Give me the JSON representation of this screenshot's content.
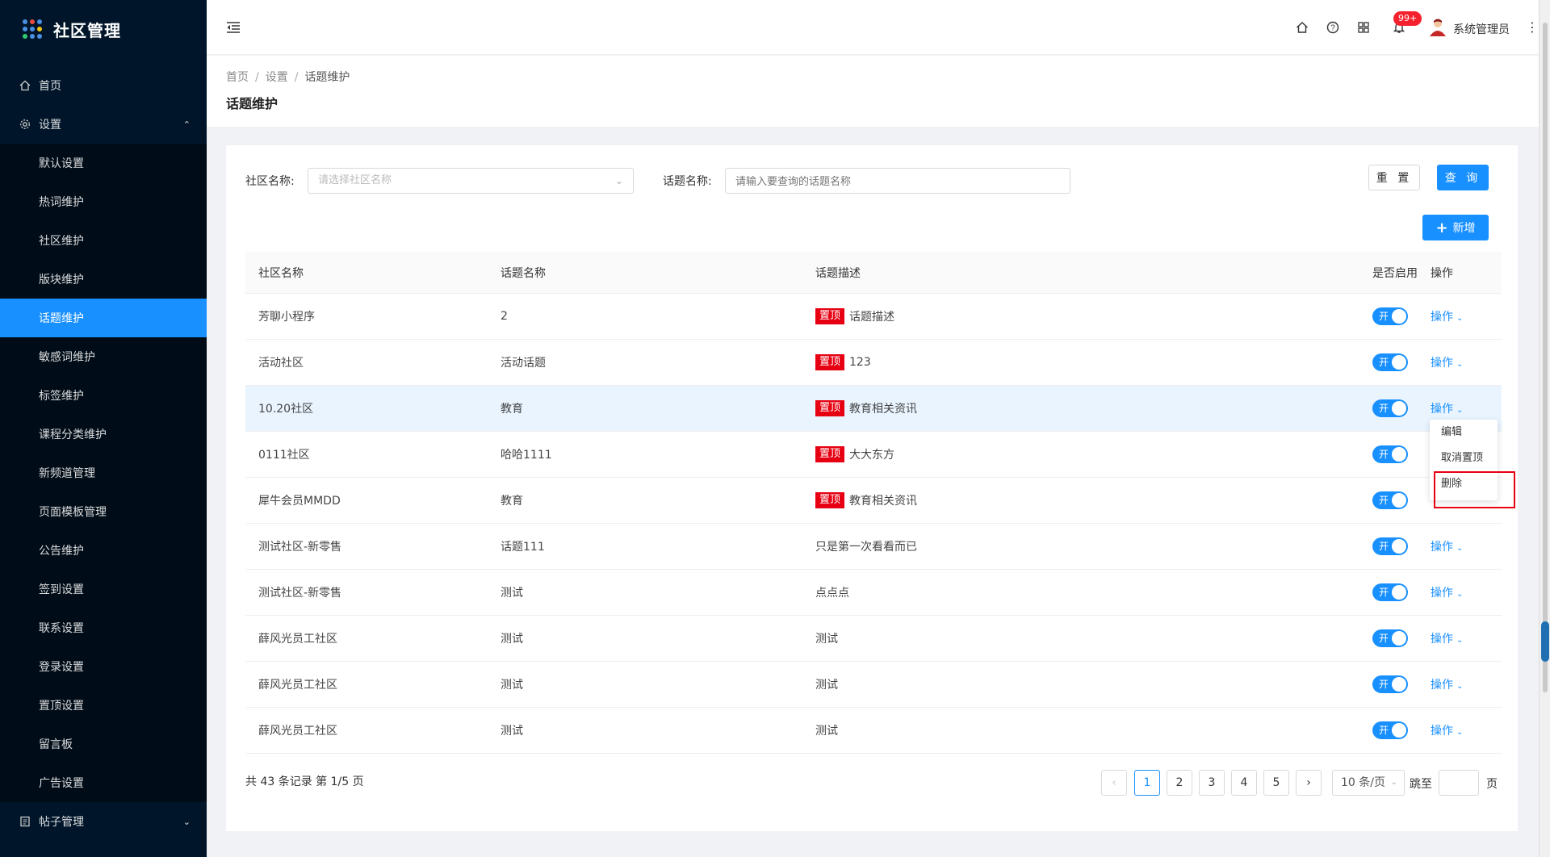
{
  "app": {
    "title": "社区管理"
  },
  "sidebar": {
    "home": "首页",
    "settings": "设置",
    "settings_items": [
      "默认设置",
      "热词维护",
      "社区维护",
      "版块维护",
      "话题维护",
      "敏感词维护",
      "标签维护",
      "课程分类维护",
      "新频道管理",
      "页面模板管理",
      "公告维护",
      "签到设置",
      "联系设置",
      "登录设置",
      "置顶设置",
      "留言板",
      "广告设置"
    ],
    "active_item": "话题维护",
    "posts": "帖子管理"
  },
  "header": {
    "badge": "99+",
    "username": "系统管理员",
    "icons": [
      "home-icon",
      "help-icon",
      "grid-icon",
      "bell-icon"
    ]
  },
  "breadcrumb": [
    "首页",
    "设置",
    "话题维护"
  ],
  "page_title": "话题维护",
  "filters": {
    "community_label": "社区名称:",
    "community_placeholder": "请选择社区名称",
    "topic_label": "话题名称:",
    "topic_placeholder": "请输入要查询的话题名称",
    "reset": "重 置",
    "query": "查 询",
    "add": "新增"
  },
  "table": {
    "headers": [
      "社区名称",
      "话题名称",
      "话题描述",
      "是否启用",
      "操作"
    ],
    "pin_label": "置顶",
    "toggle_label": "开",
    "op_label": "操作",
    "rows": [
      {
        "community": "芳聊小程序",
        "topic": "2",
        "pinned": true,
        "desc": "话题描述"
      },
      {
        "community": "活动社区",
        "topic": "活动话题",
        "pinned": true,
        "desc": "123"
      },
      {
        "community": "10.20社区",
        "topic": "教育",
        "pinned": true,
        "desc": "教育相关资讯"
      },
      {
        "community": "0111社区",
        "topic": "哈哈1111",
        "pinned": true,
        "desc": "大大东方"
      },
      {
        "community": "犀牛会员MMDD",
        "topic": "教育",
        "pinned": true,
        "desc": "教育相关资讯"
      },
      {
        "community": "测试社区-新零售",
        "topic": "话题111",
        "pinned": false,
        "desc": "只是第一次看看而已"
      },
      {
        "community": "测试社区-新零售",
        "topic": "测试",
        "pinned": false,
        "desc": "点点点"
      },
      {
        "community": "薛风光员工社区",
        "topic": "测试",
        "pinned": false,
        "desc": "测试"
      },
      {
        "community": "薛风光员工社区",
        "topic": "测试",
        "pinned": false,
        "desc": "测试"
      },
      {
        "community": "薛风光员工社区",
        "topic": "测试",
        "pinned": false,
        "desc": "测试"
      }
    ]
  },
  "dropdown": {
    "items": [
      "编辑",
      "取消置顶",
      "删除"
    ]
  },
  "pagination": {
    "total": "共 43 条记录 第 1/5 页",
    "pages": [
      "1",
      "2",
      "3",
      "4",
      "5"
    ],
    "current": "1",
    "prev": "‹",
    "next": "›",
    "page_size": "10 条/页",
    "jump_label": "跳至",
    "page_unit": "页"
  },
  "colors": {
    "accent": "#1890ff",
    "sidebar_bg": "#001529",
    "pin_red": "#e60012"
  }
}
